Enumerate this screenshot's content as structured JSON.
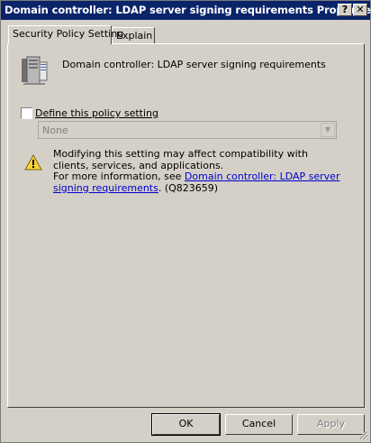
{
  "window": {
    "title": "Domain controller: LDAP server signing requirements Properties",
    "help_button": "?",
    "close_button": "✕"
  },
  "tabs": [
    {
      "label": "Security Policy Setting",
      "active": true
    },
    {
      "label": "Explain",
      "active": false
    }
  ],
  "panel": {
    "policy_name": "Domain controller: LDAP server signing requirements",
    "define_checkbox": {
      "label": "Define this policy setting",
      "checked": false
    },
    "setting_select": {
      "value": "None",
      "enabled": false
    },
    "warning": {
      "line1": "Modifying this setting may affect compatibility with clients, services, and applications.",
      "more_info_prefix": "For more information, see ",
      "link_text": "Domain controller: LDAP server signing requirements",
      "suffix": ". (Q823659)"
    }
  },
  "buttons": {
    "ok": "OK",
    "cancel": "Cancel",
    "apply": "Apply"
  }
}
